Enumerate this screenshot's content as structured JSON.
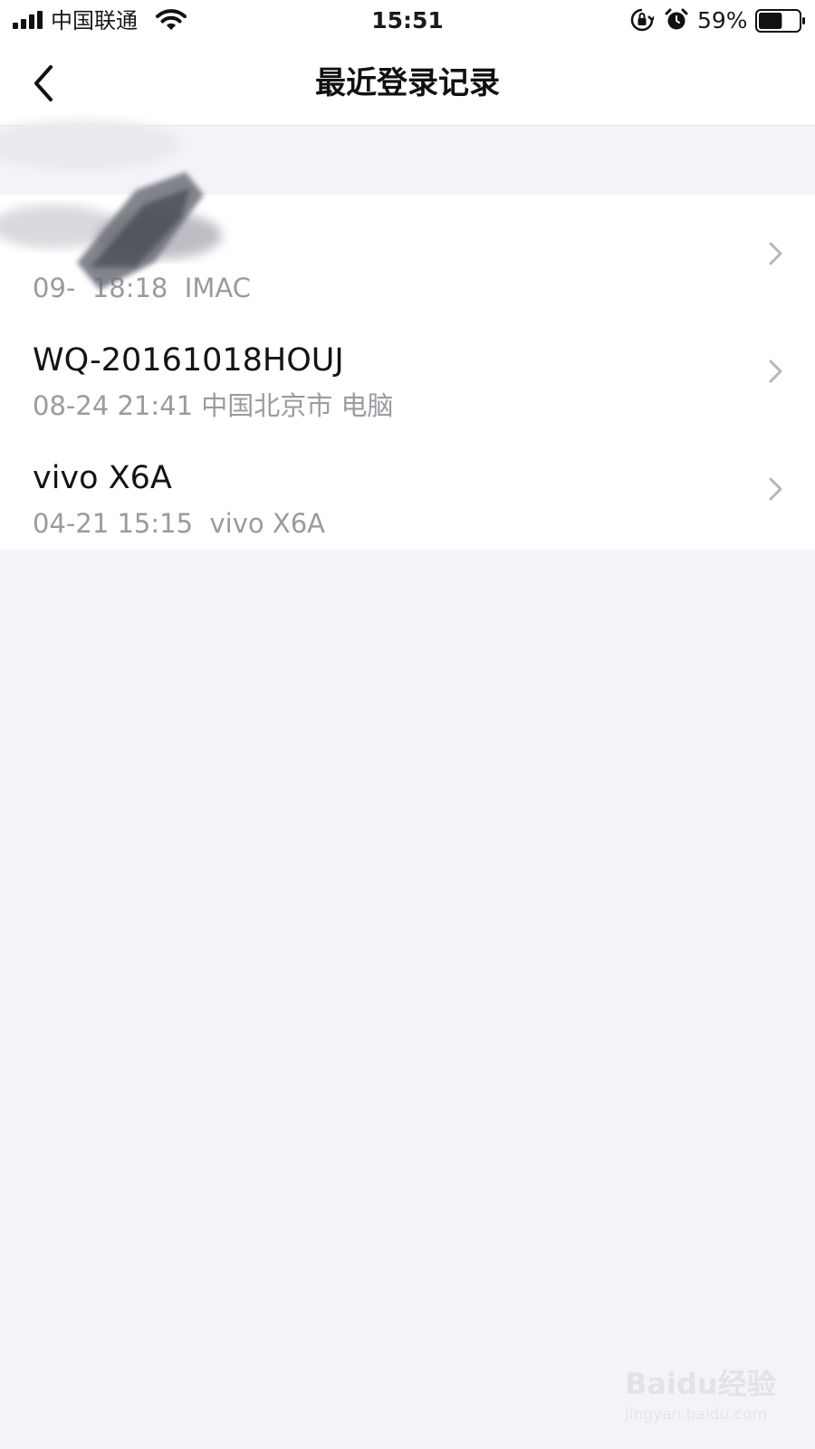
{
  "status_bar": {
    "carrier": "中国联通",
    "time": "15:51",
    "battery_percent": "59%",
    "battery_level": 0.59,
    "icons": [
      "signal-icon",
      "wifi-icon",
      "rotation-lock-icon",
      "alarm-icon",
      "battery-icon"
    ]
  },
  "nav": {
    "title": "最近登录记录",
    "back_icon": "chevron-left-icon"
  },
  "records": [
    {
      "title": "",
      "subtitle": "09-  18:18  IMAC",
      "redacted": true
    },
    {
      "title": "WQ-20161018HOUJ",
      "subtitle": "08-24 21:41 中国北京市 电脑"
    },
    {
      "title": "vivo X6A",
      "subtitle": "04-21 15:15  vivo X6A"
    }
  ],
  "watermark": {
    "main": "Baidu经验",
    "sub": "jingyan.baidu.com"
  },
  "colors": {
    "background": "#f3f4f8",
    "surface": "#ffffff",
    "primary_text": "#141414",
    "secondary_text": "#9a9aa0",
    "chevron": "#b5b5bb"
  }
}
